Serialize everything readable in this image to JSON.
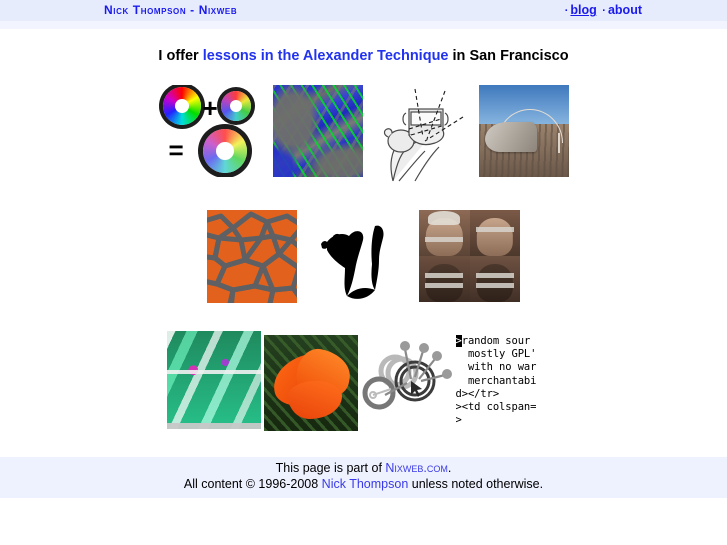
{
  "header": {
    "site_title": "Nick Thompson - Nixweb",
    "nav": {
      "sep1": "·",
      "blog": "blog",
      "sep2": "·",
      "about": "about"
    },
    "band_color": "#e7ecfd",
    "link_color": "#1a1aee"
  },
  "tagline": {
    "before": "I offer ",
    "link": "lessons in the Alexander Technique",
    "after": " in San Francisco",
    "highlight_color": "#2233ee"
  },
  "gallery": {
    "rows": [
      {
        "cells": [
          {
            "name": "color-wheel-diagram",
            "alt": "Color wheel addition diagram",
            "plus": "+",
            "equals": "="
          },
          {
            "name": "terrain-map-image",
            "alt": "Satellite terrain map of San Francisco Bay"
          },
          {
            "name": "hand-drawing-image",
            "alt": "Line drawing of a hand holding a device"
          },
          {
            "name": "desert-structure-photo",
            "alt": "Desert shade structure photograph"
          }
        ]
      },
      {
        "cells": [
          {
            "name": "orange-tessellation-image",
            "alt": "Orange interlocking tessellation pattern"
          },
          {
            "name": "ink-blot-image",
            "alt": "Black abstract ink shape"
          },
          {
            "name": "head-photo-grid",
            "alt": "Two by two grid of head photographs"
          }
        ]
      },
      {
        "cells": [
          {
            "name": "green-abstract-image",
            "alt": "Green and teal abstract glitch image"
          },
          {
            "name": "poppy-flower-photo",
            "alt": "Orange California poppy flower"
          },
          {
            "name": "technical-diagram-image",
            "alt": "Grey technical diagram with circles and pins"
          },
          {
            "name": "code-snippet-block",
            "alt": "HTML source code snippet"
          }
        ]
      }
    ]
  },
  "code_snippet": {
    "line1_sel": ">",
    "line1_rest": "random sour",
    "line2": "  mostly GPL'",
    "line3": "  with no war",
    "line4": "  merchantabi",
    "line5": "d></tr>",
    "line6": "><td colspan=",
    "line7": ">"
  },
  "footer": {
    "line1_before": "This page is part of ",
    "line1_link": "Nixweb.com",
    "line1_after": ".",
    "line2_before": "All content © 1996-2008 ",
    "line2_link": "Nick Thompson",
    "line2_after": " unless noted otherwise.",
    "band_color": "#eef1fe",
    "link_color": "#3a3ae8"
  }
}
